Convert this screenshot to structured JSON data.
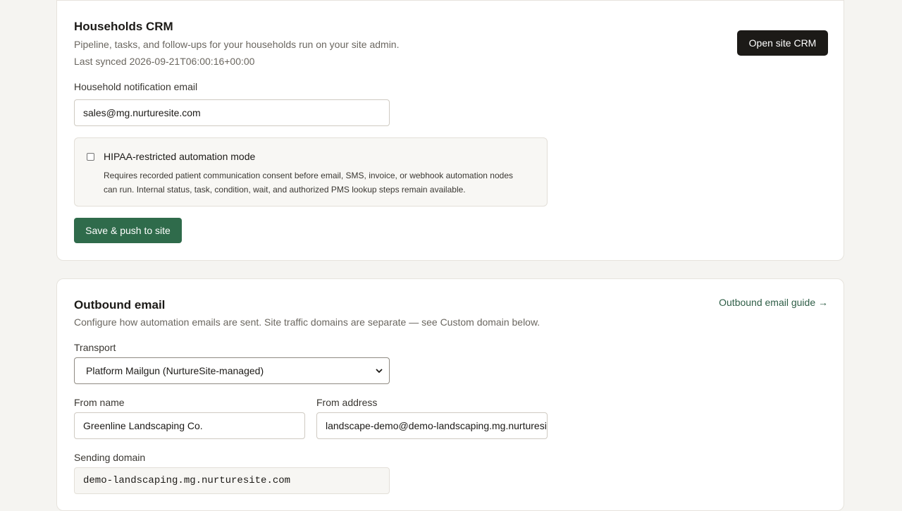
{
  "crm": {
    "title": "Households CRM",
    "description": "Pipeline, tasks, and follow-ups for your households run on your site admin.",
    "last_synced": "Last synced 2026-09-21T06:00:16+00:00",
    "open_button": "Open site CRM",
    "email_label": "Household notification email",
    "email_value": "sales@mg.nurturesite.com",
    "hipaa": {
      "label": "HIPAA-restricted automation mode",
      "description_line1": "Requires recorded patient communication consent before email, SMS, invoice, or webhook automation nodes",
      "description_line2": "can run. Internal status, task, condition, wait, and authorized PMS lookup steps remain available.",
      "checked": false
    },
    "save_button": "Save & push to site"
  },
  "outbound": {
    "title": "Outbound email",
    "description": "Configure how automation emails are sent. Site traffic domains are separate — see Custom domain below.",
    "guide_link": "Outbound email guide →",
    "transport_label": "Transport",
    "transport_value": "Platform Mailgun (NurtureSite-managed)",
    "from_name_label": "From name",
    "from_name_value": "Greenline Landscaping Co.",
    "from_address_label": "From address",
    "from_address_value": "landscape-demo@demo-landscaping.mg.nurturesite.com",
    "sending_domain_label": "Sending domain",
    "sending_domain_value": "demo-landscaping.mg.nurturesite.com"
  }
}
